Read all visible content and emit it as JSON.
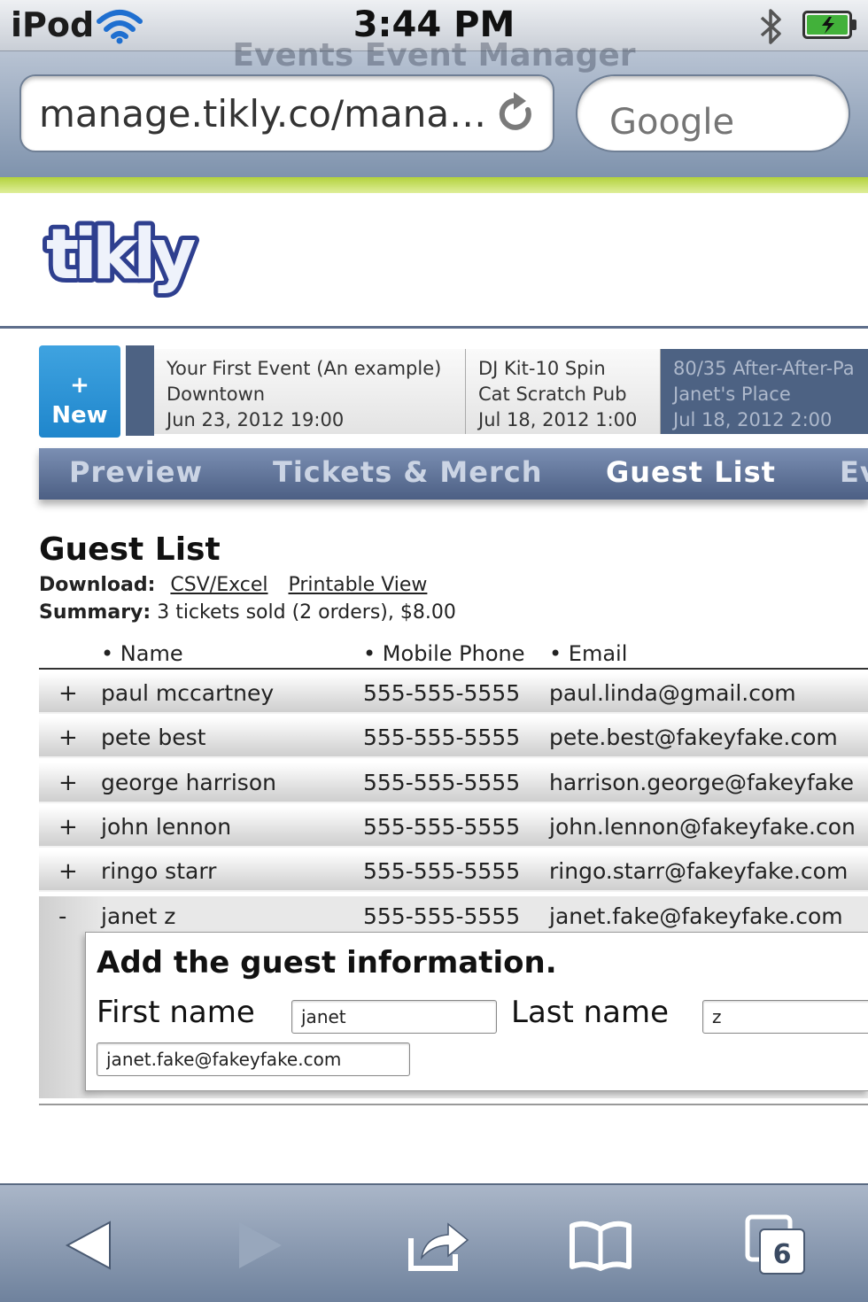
{
  "status_bar": {
    "carrier": "iPod",
    "time": "3:44 PM",
    "icons": [
      "wifi-icon",
      "bluetooth-icon",
      "battery-charging-icon"
    ]
  },
  "browser": {
    "page_title_ghost": "Events Event Manager",
    "url": "manage.tikly.co/mana…",
    "search_placeholder": "Google"
  },
  "brand": {
    "logo_text": "tikly",
    "colors": {
      "logo_fill": "#3b4d9c",
      "accent_green": "#b3d23c",
      "nav_blue": "#4c5f84",
      "new_button": "#2a92d6"
    }
  },
  "events": {
    "new_button": {
      "plus": "+",
      "label": "New"
    },
    "cards": [
      {
        "name": "Your First Event (An example)",
        "venue": "Downtown",
        "date": "Jun 23, 2012 19:00"
      },
      {
        "name": "DJ Kit-10 Spin",
        "venue": "Cat Scratch Pub",
        "date": "Jul 18, 2012 1:00"
      },
      {
        "name": "80/35 After-After-Pa",
        "venue": "Janet's Place",
        "date": "Jul 18, 2012 2:00"
      }
    ]
  },
  "nav": {
    "tabs": [
      "Preview",
      "Tickets & Merch",
      "Guest List",
      "Ev"
    ],
    "active": "Guest List"
  },
  "guest_list": {
    "title": "Guest List",
    "download_label": "Download:",
    "download_links": [
      "CSV/Excel",
      "Printable View"
    ],
    "summary_label": "Summary:",
    "summary_text": "3 tickets sold (2 orders), $8.00",
    "columns": [
      "Name",
      "Mobile Phone",
      "Email"
    ],
    "rows": [
      {
        "toggle": "+",
        "name": "paul mccartney",
        "phone": "555-555-5555",
        "email": "paul.linda@gmail.com"
      },
      {
        "toggle": "+",
        "name": "pete best",
        "phone": "555-555-5555",
        "email": "pete.best@fakeyfake.com"
      },
      {
        "toggle": "+",
        "name": "george harrison",
        "phone": "555-555-5555",
        "email": "harrison.george@fakeyfake"
      },
      {
        "toggle": "+",
        "name": "john lennon",
        "phone": "555-555-5555",
        "email": "john.lennon@fakeyfake.con"
      },
      {
        "toggle": "+",
        "name": "ringo starr",
        "phone": "555-555-5555",
        "email": "ringo.starr@fakeyfake.com"
      },
      {
        "toggle": "-",
        "name": "janet z",
        "phone": "555-555-5555",
        "email": "janet.fake@fakeyfake.com"
      }
    ],
    "edit_panel": {
      "title": "Add the guest information.",
      "first_name_label": "First name",
      "first_name_value": "janet",
      "last_name_label": "Last name",
      "last_name_value": "z",
      "email_value": "janet.fake@fakeyfake.com"
    }
  },
  "toolbar": {
    "icons": [
      "back-arrow-icon",
      "forward-arrow-icon",
      "share-icon",
      "bookmarks-icon",
      "tabs-icon"
    ],
    "tab_count": "6"
  }
}
